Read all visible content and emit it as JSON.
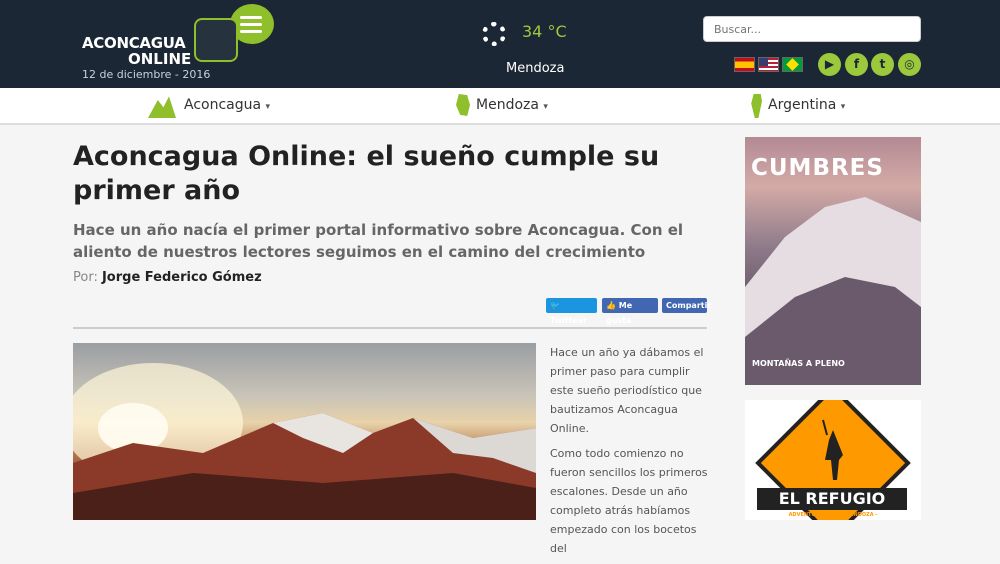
{
  "header": {
    "logo_line1": "ACONCAGUA",
    "logo_line2": "ONLINE",
    "date": "12 de diciembre - 2016",
    "weather": {
      "temp": "34 °C",
      "city": "Mendoza",
      "icon": "sun-icon"
    },
    "search_placeholder": "Buscar...",
    "languages": [
      "es-flag",
      "us-flag",
      "br-flag"
    ],
    "social": [
      "youtube-icon",
      "facebook-icon",
      "twitter-icon",
      "instagram-icon"
    ]
  },
  "nav": {
    "items": [
      {
        "label": "Aconcagua",
        "icon": "mountain-icon"
      },
      {
        "label": "Mendoza",
        "icon": "province-map-icon"
      },
      {
        "label": "Argentina",
        "icon": "country-map-icon"
      }
    ]
  },
  "article": {
    "title": "Aconcagua Online: el sueño cumple su primer año",
    "subtitle": "Hace un año nacía el primer portal informativo sobre Aconcagua. Con el aliento de nuestros lectores seguimos en el camino del crecimiento",
    "author_prefix": "Por:",
    "author": "Jorge Federico Gómez",
    "share": {
      "twitter": "Twittear",
      "like": "Me gusta",
      "share": "Compartir"
    },
    "paragraphs": [
      "Hace un año ya dábamos el primer paso para cumplir este sueño periodístico que bautizamos Aconcagua Online.",
      "Como todo comienzo no fueron sencillos los primeros escalones. Desde un año completo atrás habíamos empezado con los bocetos del"
    ]
  },
  "sidebar": {
    "magazine_title": "CUMBRES",
    "magazine_caption": "MONTAÑAS A PLENO",
    "ad_title": "EL REFUGIO",
    "ad_subtitle": "ADVENTURE GEAR · MENDOZA - ARGENTINA"
  },
  "colors": {
    "accent": "#8fbf2a",
    "header_bg": "#1c2735"
  }
}
